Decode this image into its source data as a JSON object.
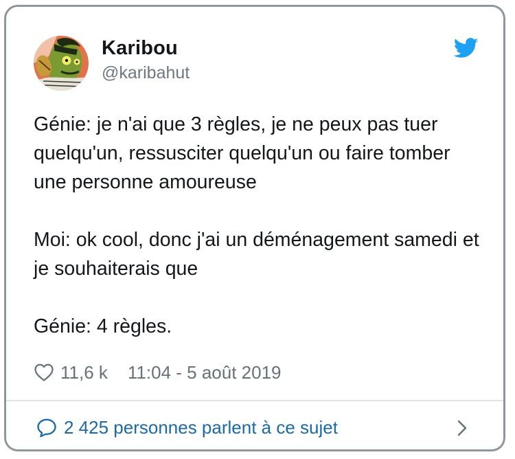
{
  "author": {
    "display_name": "Karibou",
    "handle": "@karibahut",
    "avatar_icon": "avatar-genie-illustration"
  },
  "tweet": {
    "paragraphs": [
      "Génie: je n'ai que 3 règles, je ne peux pas tuer quelqu'un, ressusciter quelqu'un ou faire tomber une personne amoureuse",
      "Moi: ok cool, donc j'ai un déménagement samedi et je souhaiterais que",
      "Génie: 4 règles."
    ]
  },
  "meta": {
    "likes": "11,6 k",
    "timestamp": "11:04 - 5 août 2019"
  },
  "footer": {
    "conversation_label": "2 425 personnes parlent à ce sujet"
  },
  "icons": {
    "brand": "twitter-bird-icon",
    "like": "heart-icon",
    "conversation": "speech-bubble-icon",
    "more": "chevron-right-icon"
  },
  "colors": {
    "twitter_blue": "#1da1f2",
    "link_blue": "#1b6aa8",
    "secondary_text": "#66717a",
    "border": "#8f969c"
  }
}
